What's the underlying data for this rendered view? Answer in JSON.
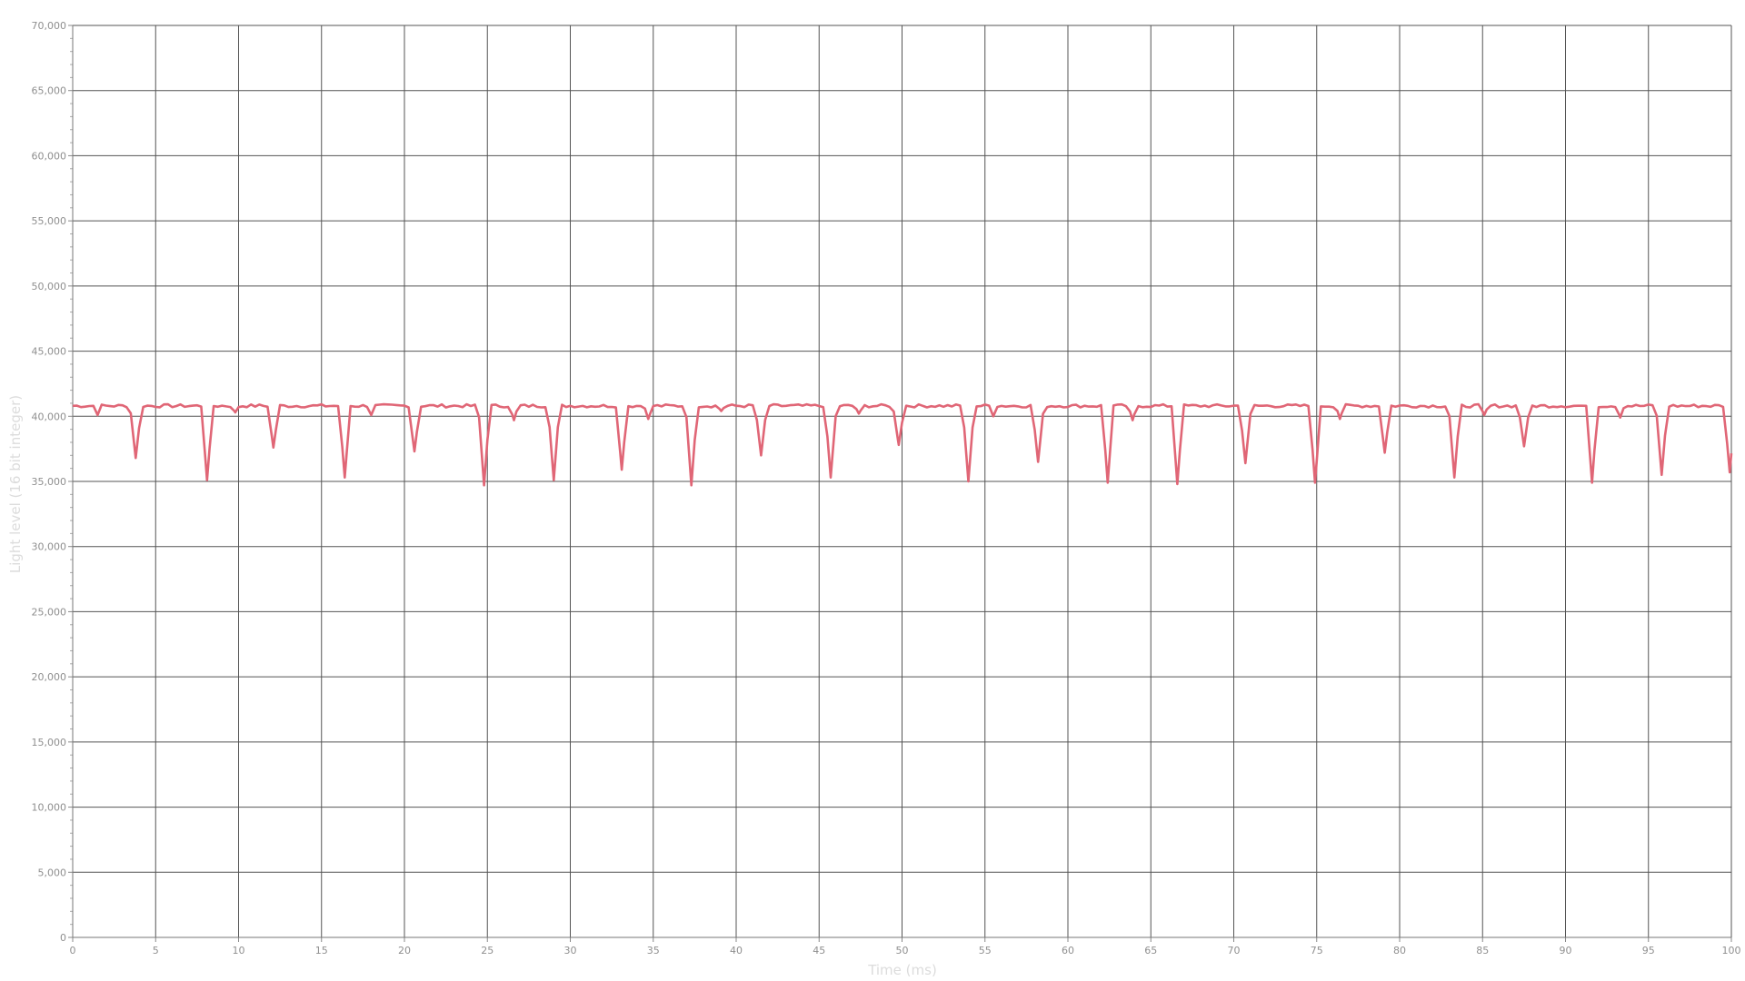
{
  "chart_data": {
    "type": "line",
    "title": "",
    "xlabel": "Time (ms)",
    "ylabel": "Light level (16 bit integer)",
    "xlim": [
      0,
      100
    ],
    "ylim": [
      0,
      70000
    ],
    "x_ticks": [
      0,
      5,
      10,
      15,
      20,
      25,
      30,
      35,
      40,
      45,
      50,
      55,
      60,
      65,
      70,
      75,
      80,
      85,
      90,
      95,
      100
    ],
    "y_ticks": [
      0,
      5000,
      10000,
      15000,
      20000,
      25000,
      30000,
      35000,
      40000,
      45000,
      50000,
      55000,
      60000,
      65000,
      70000
    ],
    "x_tick_labels": [
      "0",
      "5",
      "10",
      "15",
      "20",
      "25",
      "30",
      "35",
      "40",
      "45",
      "50",
      "55",
      "60",
      "65",
      "70",
      "75",
      "80",
      "85",
      "90",
      "95",
      "100"
    ],
    "y_tick_labels": [
      "0",
      "5,000",
      "10,000",
      "15,000",
      "20,000",
      "25,000",
      "30,000",
      "35,000",
      "40,000",
      "45,000",
      "50,000",
      "55,000",
      "60,000",
      "65,000",
      "70,000"
    ],
    "grid": true,
    "legend": "none",
    "series": [
      {
        "color": "#e06676",
        "baseline": 40800,
        "dips": [
          {
            "x": 3.8,
            "y": 36800
          },
          {
            "x": 8.1,
            "y": 35100
          },
          {
            "x": 12.1,
            "y": 37600
          },
          {
            "x": 16.4,
            "y": 35300
          },
          {
            "x": 20.6,
            "y": 37300
          },
          {
            "x": 24.8,
            "y": 34700
          },
          {
            "x": 29.0,
            "y": 35100
          },
          {
            "x": 33.1,
            "y": 35900
          },
          {
            "x": 37.3,
            "y": 34700
          },
          {
            "x": 41.5,
            "y": 37000
          },
          {
            "x": 45.7,
            "y": 35300
          },
          {
            "x": 49.8,
            "y": 37800
          },
          {
            "x": 54.0,
            "y": 35000
          },
          {
            "x": 58.2,
            "y": 36500
          },
          {
            "x": 62.4,
            "y": 34900
          },
          {
            "x": 66.6,
            "y": 34800
          },
          {
            "x": 70.7,
            "y": 36400
          },
          {
            "x": 74.9,
            "y": 34900
          },
          {
            "x": 79.1,
            "y": 37200
          },
          {
            "x": 83.3,
            "y": 35300
          },
          {
            "x": 87.5,
            "y": 37700
          },
          {
            "x": 91.6,
            "y": 34900
          },
          {
            "x": 95.8,
            "y": 35500
          },
          {
            "x": 99.9,
            "y": 35700
          }
        ],
        "small_dips": [
          {
            "x": 1.5,
            "y": 40100
          },
          {
            "x": 9.8,
            "y": 40300
          },
          {
            "x": 18.0,
            "y": 40100
          },
          {
            "x": 26.6,
            "y": 39700
          },
          {
            "x": 34.7,
            "y": 39800
          },
          {
            "x": 39.1,
            "y": 40400
          },
          {
            "x": 47.4,
            "y": 40200
          },
          {
            "x": 55.5,
            "y": 40000
          },
          {
            "x": 63.9,
            "y": 39700
          },
          {
            "x": 76.4,
            "y": 39800
          },
          {
            "x": 85.1,
            "y": 40100
          },
          {
            "x": 93.3,
            "y": 39900
          }
        ]
      }
    ]
  }
}
